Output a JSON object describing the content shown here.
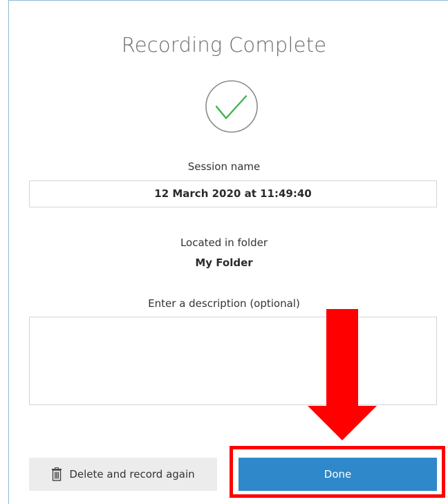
{
  "dialog": {
    "title": "Recording Complete",
    "session_label": "Session name",
    "session_value": "12 March 2020 at 11:49:40",
    "folder_label": "Located in folder",
    "folder_value": "My Folder",
    "description_label": "Enter a description (optional)",
    "description_value": ""
  },
  "buttons": {
    "delete_label": "Delete and record again",
    "done_label": "Done"
  },
  "colors": {
    "accent": "#2e88c9",
    "check_green": "#3fb54a",
    "annotation_red": "#ff0000"
  }
}
